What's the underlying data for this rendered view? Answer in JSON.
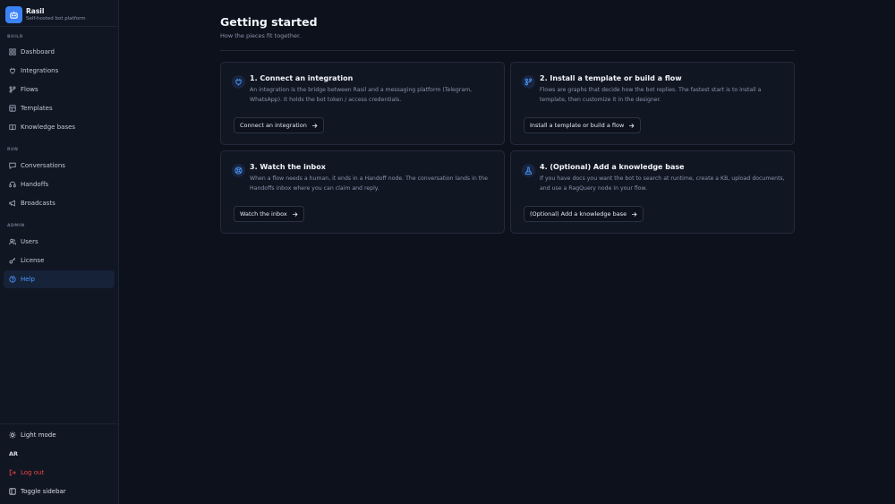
{
  "brand": {
    "name": "Rasil",
    "tagline": "Self-hosted bot platform"
  },
  "sidebar": {
    "sections": [
      {
        "label": "BUILD",
        "items": [
          {
            "label": "Dashboard",
            "icon": "dashboard-icon"
          },
          {
            "label": "Integrations",
            "icon": "plug-icon"
          },
          {
            "label": "Flows",
            "icon": "flow-icon"
          },
          {
            "label": "Templates",
            "icon": "template-icon"
          },
          {
            "label": "Knowledge bases",
            "icon": "book-icon"
          }
        ]
      },
      {
        "label": "RUN",
        "items": [
          {
            "label": "Conversations",
            "icon": "chat-icon"
          },
          {
            "label": "Handoffs",
            "icon": "headset-icon"
          },
          {
            "label": "Broadcasts",
            "icon": "megaphone-icon"
          }
        ]
      },
      {
        "label": "ADMIN",
        "items": [
          {
            "label": "Users",
            "icon": "users-icon"
          },
          {
            "label": "License",
            "icon": "key-icon"
          },
          {
            "label": "Help",
            "icon": "help-icon",
            "active": true
          }
        ]
      }
    ],
    "bottom": {
      "theme_toggle": "Light mode",
      "user_initials": "AR",
      "logout": "Log out",
      "toggle_sidebar": "Toggle sidebar"
    }
  },
  "page": {
    "title": "Getting started",
    "subtitle": "How the pieces fit together."
  },
  "cards": [
    {
      "title": "1. Connect an integration",
      "description": "An integration is the bridge between Rasil and a messaging platform (Telegram, WhatsApp). It holds the bot token / access credentials.",
      "button": "Connect an integration",
      "icon": "plug-icon"
    },
    {
      "title": "2. Install a template or build a flow",
      "description": "Flows are graphs that decide how the bot replies. The fastest start is to install a template, then customize it in the designer.",
      "button": "Install a template or build a flow",
      "icon": "flow-icon"
    },
    {
      "title": "3. Watch the inbox",
      "description": "When a flow needs a human, it ends in a Handoff node. The conversation lands in the Handoffs inbox where you can claim and reply.",
      "button": "Watch the inbox",
      "icon": "lifebuoy-icon"
    },
    {
      "title": "4. (Optional) Add a knowledge base",
      "description": "If you have docs you want the bot to search at runtime, create a KB, upload documents, and use a RagQuery node in your flow.",
      "button": "(Optional) Add a knowledge base",
      "icon": "flask-icon"
    }
  ],
  "colors": {
    "accent": "#3b82f6",
    "danger": "#ef4444",
    "background": "#0d111c"
  }
}
